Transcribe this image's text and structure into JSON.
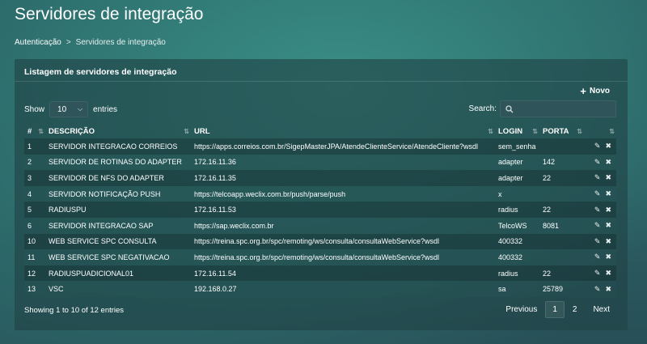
{
  "page": {
    "title": "Servidores de integração",
    "breadcrumb": {
      "parent": "Autenticação",
      "separator": ">",
      "current": "Servidores de integração"
    }
  },
  "panel": {
    "title": "Listagem de servidores de integração",
    "new_label": "Novo",
    "show_label": "Show",
    "entries_value": "10",
    "entries_label": "entries",
    "search_label": "Search:",
    "search_value": ""
  },
  "table": {
    "headers": {
      "num": "#",
      "descricao": "DESCRIÇÃO",
      "url": "URL",
      "login": "LOGIN",
      "porta": "PORTA"
    },
    "rows": [
      {
        "num": "1",
        "descricao": "SERVIDOR INTEGRACAO CORREIOS",
        "url": "https://apps.correios.com.br/SigepMasterJPA/AtendeClienteService/AtendeCliente?wsdl",
        "login": "sem_senha",
        "porta": ""
      },
      {
        "num": "2",
        "descricao": "SERVIDOR DE ROTINAS DO ADAPTER",
        "url": "172.16.11.36",
        "login": "adapter",
        "porta": "142"
      },
      {
        "num": "3",
        "descricao": "SERVIDOR DE NFS DO ADAPTER",
        "url": "172.16.11.35",
        "login": "adapter",
        "porta": "22"
      },
      {
        "num": "4",
        "descricao": "SERVIDOR NOTIFICAÇÃO PUSH",
        "url": "https://telcoapp.weclix.com.br/push/parse/push",
        "login": "x",
        "porta": ""
      },
      {
        "num": "5",
        "descricao": "RADIUSPU",
        "url": "172.16.11.53",
        "login": "radius",
        "porta": "22"
      },
      {
        "num": "6",
        "descricao": "SERVIDOR INTEGRACAO SAP",
        "url": "https://sap.weclix.com.br",
        "login": "TelcoWS",
        "porta": "8081"
      },
      {
        "num": "10",
        "descricao": "WEB SERVICE SPC CONSULTA",
        "url": "https://treina.spc.org.br/spc/remoting/ws/consulta/consultaWebService?wsdl",
        "login": "400332",
        "porta": ""
      },
      {
        "num": "11",
        "descricao": "WEB SERVICE SPC NEGATIVACAO",
        "url": "https://treina.spc.org.br/spc/remoting/ws/consulta/consultaWebService?wsdl",
        "login": "400332",
        "porta": ""
      },
      {
        "num": "12",
        "descricao": "RADIUSPUADICIONAL01",
        "url": "172.16.11.54",
        "login": "radius",
        "porta": "22"
      },
      {
        "num": "13",
        "descricao": "VSC",
        "url": "192.168.0.27",
        "login": "sa",
        "porta": "25789"
      }
    ]
  },
  "footer": {
    "info": "Showing 1 to 10 of 12 entries",
    "previous": "Previous",
    "pages": [
      "1",
      "2"
    ],
    "next": "Next"
  },
  "icons": {
    "new": "plus-icon",
    "search": "search-icon",
    "edit": "edit-icon",
    "delete": "delete-icon",
    "sort": "sort-icon"
  }
}
